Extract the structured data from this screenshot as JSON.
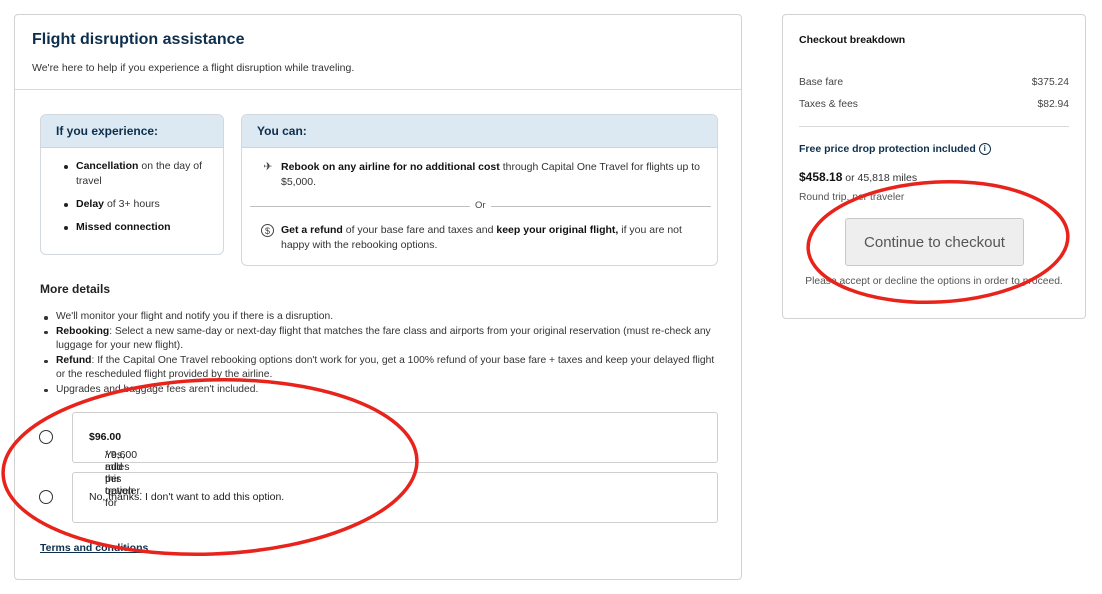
{
  "main": {
    "title": "Flight disruption assistance",
    "subtitle": "We're here to help if you experience a flight disruption while traveling."
  },
  "experience": {
    "heading": "If you experience:",
    "items": [
      {
        "bold": "Cancellation",
        "rest": " on the day of travel"
      },
      {
        "bold": "Delay",
        "rest": " of 3+ hours"
      },
      {
        "bold": "Missed connection",
        "rest": ""
      }
    ]
  },
  "you_can": {
    "heading": "You can:",
    "option1": {
      "bold": "Rebook on any airline for no additional cost",
      "rest": " through Capital One Travel for flights up to $5,000."
    },
    "or_label": "Or",
    "option2": {
      "bold1": "Get a refund",
      "mid": " of your base fare and taxes and ",
      "bold2": "keep your original flight,",
      "rest": " if you are not happy with the rebooking options."
    }
  },
  "more_details": {
    "title": "More details",
    "item1": "We'll monitor your flight and notify you if there is a disruption.",
    "item2_bold": "Rebooking",
    "item2_rest": ": Select a new same-day or next-day flight that matches the fare class and airports from your original reservation (must re-check any luggage for your new flight).",
    "item3_bold": "Refund",
    "item3_rest": ": If the Capital One Travel rebooking options don't work for you, get a 100% refund of your base fare + taxes and keep your delayed flight or the rescheduled flight provided by the airline.",
    "item4": "Upgrades and baggage fees aren't included."
  },
  "choices": {
    "yes_prefix": "Yes, add this option for ",
    "yes_price": "$96.00",
    "yes_suffix": " / 9,600 miles per traveler.",
    "no_label": "No, thanks. I don't want to add this option."
  },
  "terms_label": "Terms and conditions",
  "checkout": {
    "title": "Checkout breakdown",
    "base_fare_label": "Base fare",
    "base_fare_value": "$375.24",
    "taxes_label": "Taxes & fees",
    "taxes_value": "$82.94",
    "free_protection": "Free price drop protection included",
    "total_price": "$458.18",
    "total_miles": " or 45,818 miles",
    "round_trip_note": "Round trip, per traveler",
    "button_label": "Continue to checkout",
    "accept_note": "Please accept or decline the options in order to proceed."
  },
  "icons": {
    "rebook": "airplane-icon",
    "refund": "dollar-circle-icon",
    "info": "info-icon"
  },
  "colors": {
    "heading_navy": "#0d2f4d",
    "box_header_bg": "#dde9f2",
    "annotation_red": "#e8231b"
  }
}
